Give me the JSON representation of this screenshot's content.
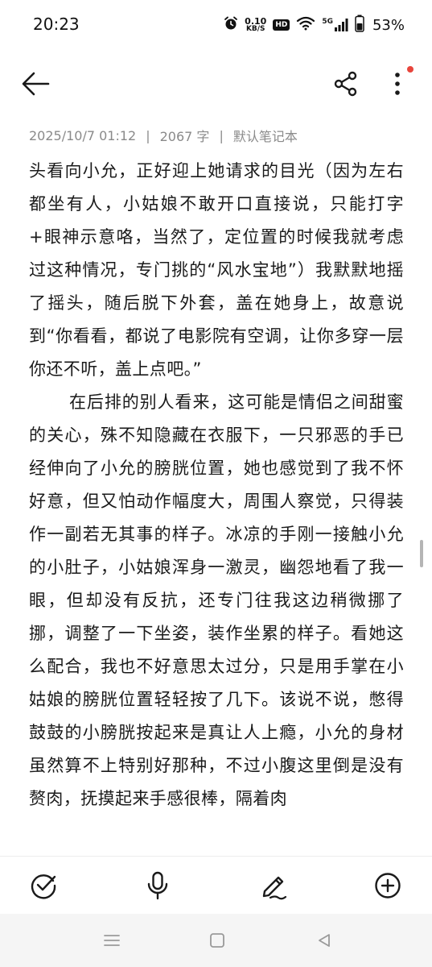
{
  "status_bar": {
    "time": "20:23",
    "net_speed_value": "0.10",
    "net_speed_unit": "KB/S",
    "hd_label": "HD",
    "signal_label": "5G",
    "battery_percent": "53%"
  },
  "header": {
    "back_icon": "arrow-left-icon",
    "share_icon": "share-icon",
    "more_icon": "more-vertical-icon",
    "notification_dot_color": "#e8453c"
  },
  "meta": {
    "date": "2025/10/7 01:12",
    "word_count": "2067 字",
    "notebook": "默认笔记本",
    "separator": "|"
  },
  "content": {
    "paragraphs": [
      "头看向小允，正好迎上她请求的目光（因为左右都坐有人，小姑娘不敢开口直接说，只能打字+眼神示意咯，当然了，定位置的时候我就考虑过这种情况，专门挑的“风水宝地”）我默默地摇了摇头，随后脱下外套，盖在她身上，故意说到“你看看，都说了电影院有空调，让你多穿一层你还不听，盖上点吧。”",
      "在后排的别人看来，这可能是情侣之间甜蜜的关心，殊不知隐藏在衣服下，一只邪恶的手已经伸向了小允的膀胱位置，她也感觉到了我不怀好意，但又怕动作幅度大，周围人察觉，只得装作一副若无其事的样子。冰凉的手刚一接触小允的小肚子，小姑娘浑身一激灵，幽怨地看了我一眼，但却没有反抗，还专门往我这边稍微挪了挪，调整了一下坐姿，装作坐累的样子。看她这么配合，我也不好意思太过分，只是用手掌在小姑娘的膀胱位置轻轻按了几下。该说不说，憋得鼓鼓的小膀胱按起来是真让人上瘾，小允的身材虽然算不上特别好那种，不过小腹这里倒是没有赘肉，抚摸起来手感很棒，隔着肉"
    ]
  },
  "toolbar": {
    "items": [
      "check-circle-icon",
      "microphone-icon",
      "pen-icon",
      "add-circle-icon"
    ]
  },
  "nav_bar": {
    "items": [
      "menu-icon",
      "home-icon",
      "back-triangle-icon"
    ]
  },
  "colors": {
    "text": "#1a1a1a",
    "meta_text": "#8a8a8a",
    "accent_dot": "#e8453c",
    "nav_bg": "#f5f5f5"
  }
}
